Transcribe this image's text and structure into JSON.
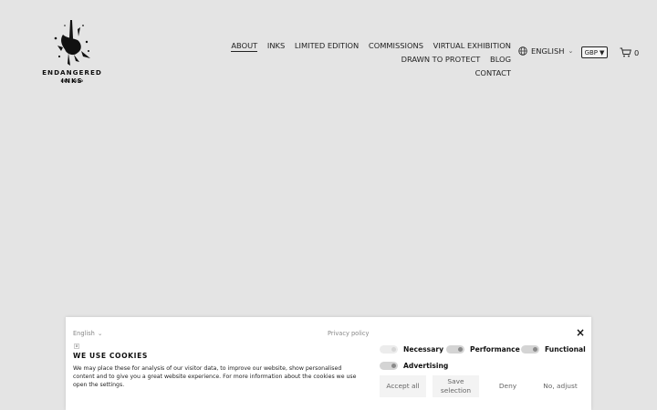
{
  "brand": {
    "name": "ENDANGERED INKS",
    "est": "EST. 2020"
  },
  "nav": {
    "items": [
      {
        "label": "ABOUT",
        "active": true
      },
      {
        "label": "INKS"
      },
      {
        "label": "LIMITED EDITION"
      },
      {
        "label": "COMMISSIONS"
      },
      {
        "label": "VIRTUAL EXHIBITION"
      },
      {
        "label": "DRAWN TO PROTECT"
      },
      {
        "label": "BLOG"
      },
      {
        "label": "CONTACT"
      }
    ]
  },
  "language": {
    "label": "ENGLISH",
    "icon": "globe-icon"
  },
  "currency": {
    "label": "GBP",
    "icon": "caret-down-icon"
  },
  "cart": {
    "count": "0",
    "icon": "cart-icon"
  },
  "cookie_banner": {
    "language": "English",
    "privacy_link": "Privacy policy",
    "close_label": "×",
    "badge": "x",
    "title": "WE USE COOKIES",
    "text": "We may place these for analysis of our visitor data, to improve our website, show personalised content and to give you a great website experience. For more information about the cookies we use open the settings.",
    "toggles": {
      "necessary": "Necessary",
      "performance": "Performance",
      "functional": "Functional",
      "advertising": "Advertising"
    },
    "buttons": {
      "accept_all": "Accept all",
      "save_selection": "Save selection",
      "deny": "Deny",
      "no_adjust": "No, adjust"
    }
  },
  "colors": {
    "page_bg": "#e4e4e4",
    "banner_bg": "#ffffff",
    "text": "#222222"
  }
}
